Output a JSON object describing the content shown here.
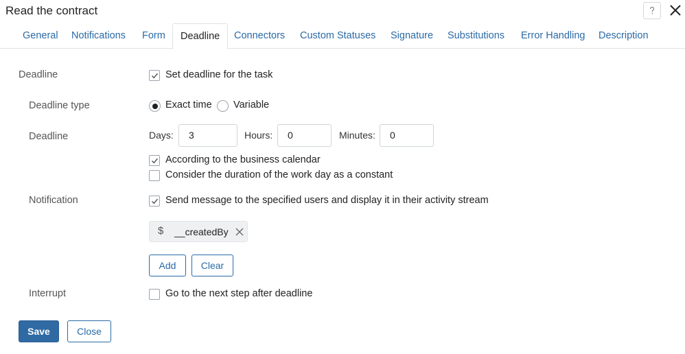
{
  "window": {
    "title": "Read the contract",
    "help_icon": "help-icon",
    "close_icon": "close-icon"
  },
  "tabs": [
    {
      "label": "General",
      "active": false
    },
    {
      "label": "Notifications",
      "active": false
    },
    {
      "label": "Form",
      "active": false
    },
    {
      "label": "Deadline",
      "active": true
    },
    {
      "label": "Connectors",
      "active": false
    },
    {
      "label": "Custom Statuses",
      "active": false
    },
    {
      "label": "Signature",
      "active": false
    },
    {
      "label": "Substitutions",
      "active": false
    },
    {
      "label": "Error Handling",
      "active": false
    },
    {
      "label": "Description",
      "active": false
    }
  ],
  "deadline": {
    "label": "Deadline",
    "set_deadline": {
      "label": "Set deadline for the task",
      "checked": true
    }
  },
  "deadline_type": {
    "label": "Deadline type",
    "options": [
      {
        "label": "Exact time",
        "selected": true
      },
      {
        "label": "Variable",
        "selected": false
      }
    ]
  },
  "deadline_values": {
    "label": "Deadline",
    "days": {
      "label": "Days:",
      "value": "3"
    },
    "hours": {
      "label": "Hours:",
      "value": "0"
    },
    "minutes": {
      "label": "Minutes:",
      "value": "0"
    },
    "business_calendar": {
      "label": "According to the business calendar",
      "checked": true
    },
    "work_day_constant": {
      "label": "Consider the duration of the work day as a constant",
      "checked": false
    }
  },
  "notification": {
    "label": "Notification",
    "send_message": {
      "label": "Send message to the specified users and display it in their activity stream",
      "checked": true
    },
    "chip": {
      "prefix": "$",
      "text": "__createdBy"
    },
    "add_label": "Add",
    "clear_label": "Clear"
  },
  "interrupt": {
    "label": "Interrupt",
    "next_step": {
      "label": "Go to the next step after deadline",
      "checked": false
    }
  },
  "footer": {
    "save_label": "Save",
    "close_label": "Close"
  },
  "colors": {
    "accent": "#2a6aa6",
    "primary_button": "#2f6aa3"
  }
}
